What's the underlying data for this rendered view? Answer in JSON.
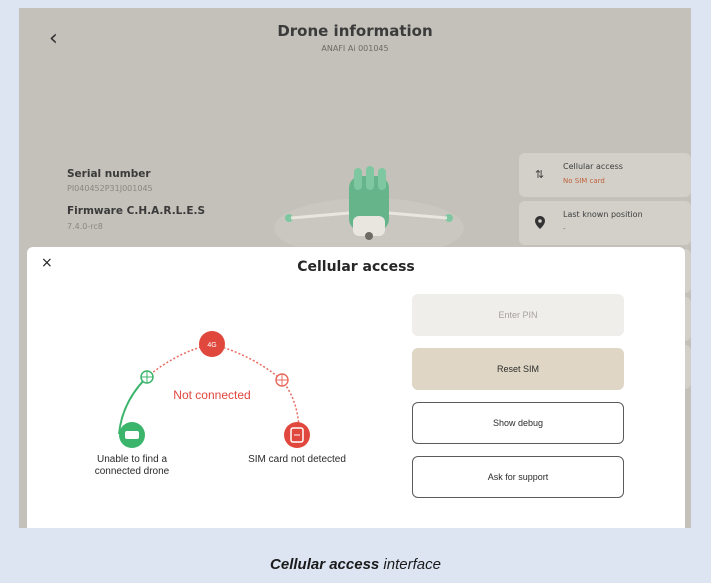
{
  "header": {
    "back_icon": "‹",
    "title": "Drone information",
    "subtitle": "ANAFI Ai 001045"
  },
  "info": {
    "serial_label": "Serial number",
    "serial_value": "PI040452P31J001045",
    "firmware_label": "Firmware C.H.A.R.L.E.S",
    "firmware_value": "7.4.0-rc8"
  },
  "cards": {
    "cellular_title": "Cellular access",
    "cellular_status": "No SIM card",
    "position_title": "Last known position",
    "position_value": "-"
  },
  "modal": {
    "close_icon": "×",
    "title": "Cellular access",
    "enter_pin": "Enter PIN",
    "reset_sim": "Reset SIM",
    "show_debug": "Show debug",
    "ask_support": "Ask for support"
  },
  "diagram": {
    "status_text": "Not connected",
    "badge_4g": "4G",
    "drone_label_line1": "Unable to find a",
    "drone_label_line2": "connected drone",
    "sim_label": "SIM card not detected",
    "colors": {
      "red": "#e0473d",
      "green": "#3bb56c",
      "link": "#e86b5f"
    }
  },
  "caption": {
    "bold": "Cellular access",
    "rest": " interface"
  }
}
